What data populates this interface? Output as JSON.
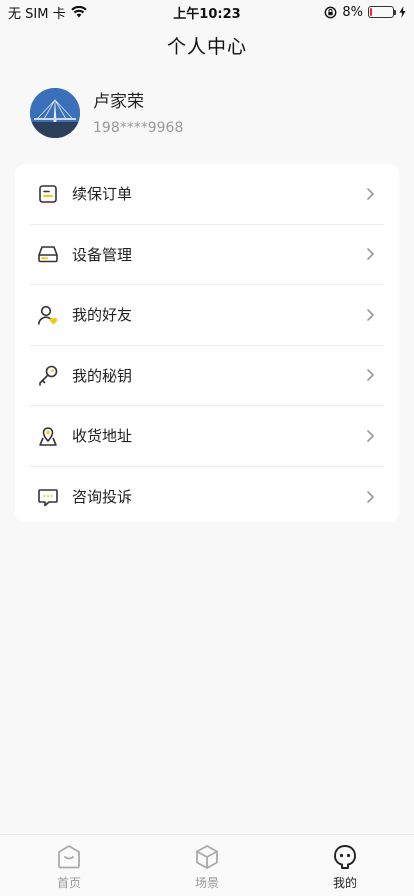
{
  "status_bar": {
    "carrier": "无 SIM 卡",
    "time": "上午10:23",
    "battery_percent": "8%",
    "battery_level": 0.08,
    "icons": [
      "wifi-icon",
      "rotation-lock-icon",
      "battery-icon",
      "charging-icon"
    ]
  },
  "header": {
    "title": "个人中心"
  },
  "profile": {
    "name": "卢家荣",
    "phone": "198****9968"
  },
  "menu": {
    "items": [
      {
        "label": "续保订单",
        "icon": "order-icon"
      },
      {
        "label": "设备管理",
        "icon": "device-icon"
      },
      {
        "label": "我的好友",
        "icon": "friend-icon"
      },
      {
        "label": "我的秘钥",
        "icon": "key-icon"
      },
      {
        "label": "收货地址",
        "icon": "location-icon"
      },
      {
        "label": "咨询投诉",
        "icon": "message-icon"
      }
    ]
  },
  "tab_bar": {
    "tabs": [
      {
        "label": "首页",
        "icon": "home-icon",
        "active": false
      },
      {
        "label": "场景",
        "icon": "cube-icon",
        "active": false
      },
      {
        "label": "我的",
        "icon": "profile-face-icon",
        "active": true
      }
    ]
  },
  "colors": {
    "accent": "#f5c518",
    "text": "#222222",
    "muted": "#999999"
  }
}
